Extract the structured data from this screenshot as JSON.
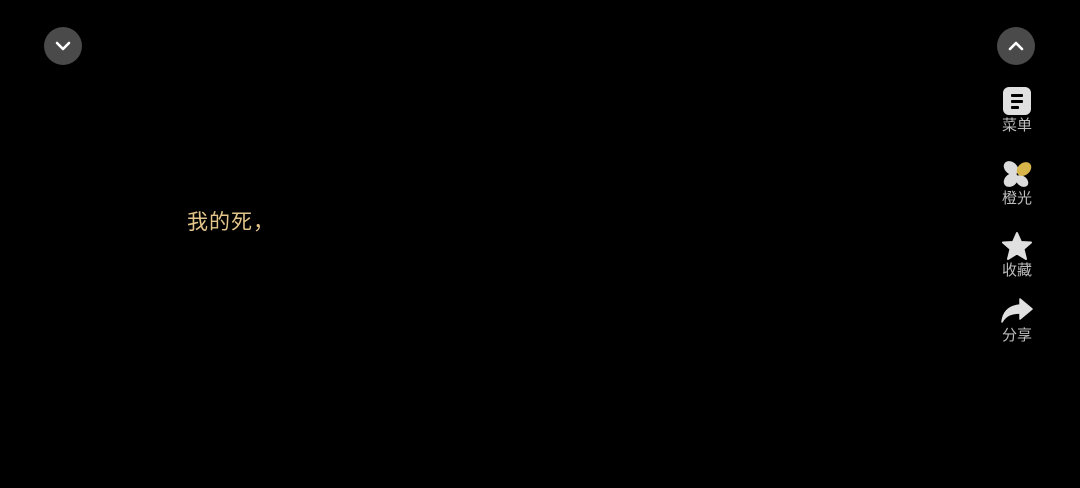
{
  "player": {
    "caption": "我的死，",
    "caption_color": "#e3c58a",
    "collapse_icon": "chevron-down-icon",
    "expand_icon": "chevron-up-icon"
  },
  "sidebar": {
    "items": [
      {
        "label": "菜单",
        "icon": "menu-icon"
      },
      {
        "label": "橙光",
        "icon": "orange-light-icon"
      },
      {
        "label": "收藏",
        "icon": "star-icon"
      },
      {
        "label": "分享",
        "icon": "share-icon"
      }
    ]
  }
}
